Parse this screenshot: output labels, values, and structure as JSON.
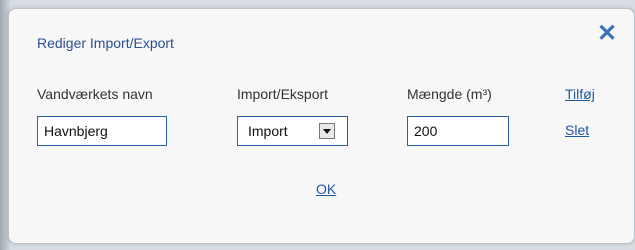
{
  "dialog": {
    "title": "Rediger Import/Export",
    "close_icon": "close-icon"
  },
  "columns": {
    "waterworks_name": "Vandværkets navn",
    "import_export": "Import/Eksport",
    "amount": "Mængde (m³)"
  },
  "links": {
    "add": "Tilføj",
    "delete": "Slet",
    "ok": "OK"
  },
  "row": {
    "name_value": "Havnbjerg",
    "type_value": "Import",
    "amount_value": "200"
  },
  "colors": {
    "accent": "#2257a6",
    "title": "#2c4f8f",
    "dialog_bg": "#f7f7f7"
  }
}
